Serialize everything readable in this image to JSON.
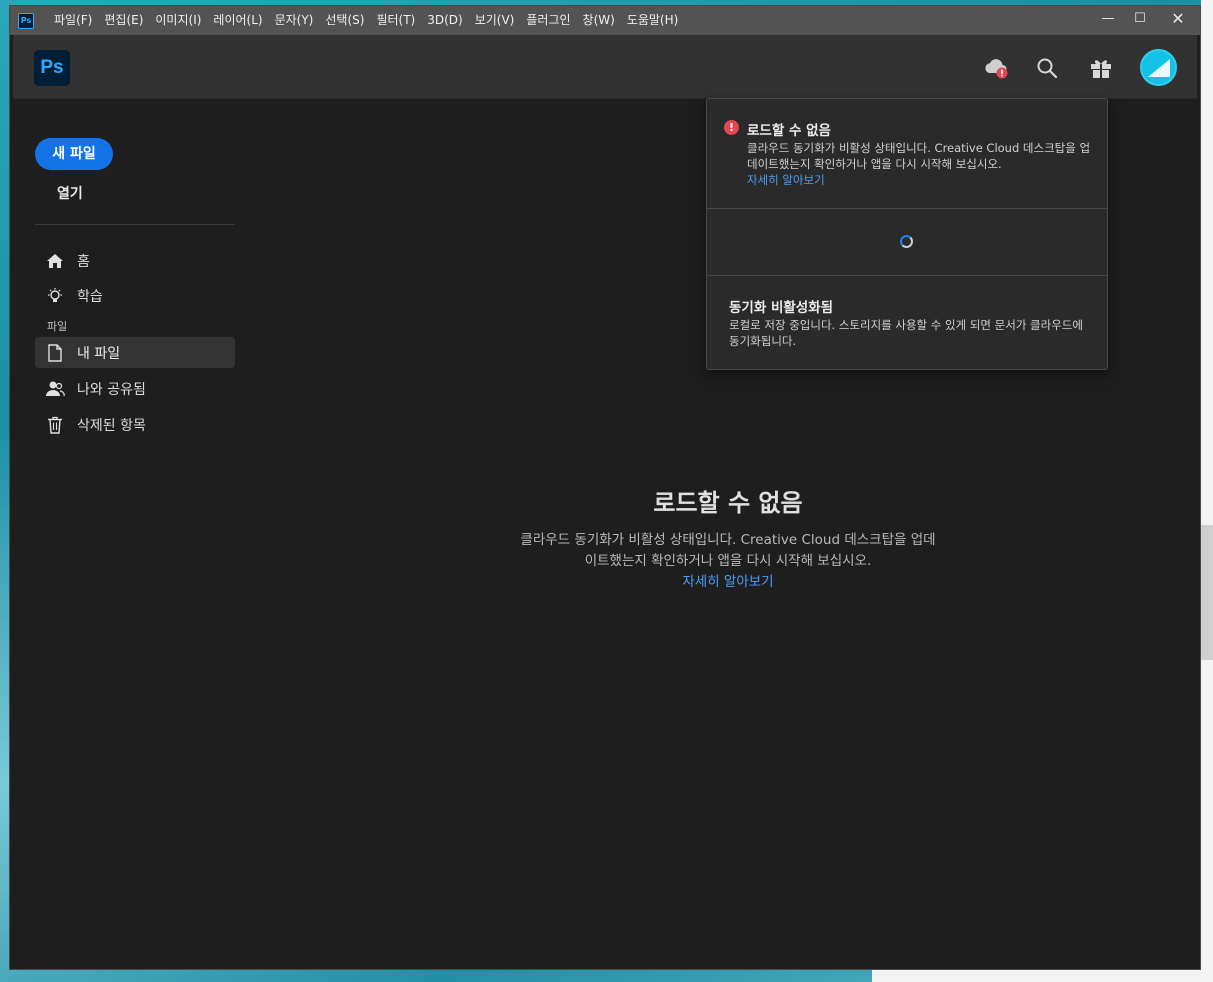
{
  "app": {
    "mini_icon": "Ps"
  },
  "menu": [
    "파일(F)",
    "편집(E)",
    "이미지(I)",
    "레이어(L)",
    "문자(Y)",
    "선택(S)",
    "필터(T)",
    "3D(D)",
    "보기(V)",
    "플러그인",
    "창(W)",
    "도움말(H)"
  ],
  "window_controls": {
    "minimize": "—",
    "maximize": "☐",
    "close": "✕"
  },
  "header": {
    "logo": "Ps",
    "icons": [
      "cloud-error-icon",
      "search-icon",
      "gift-icon"
    ]
  },
  "sidebar": {
    "new_file": "새 파일",
    "open": "열기",
    "home": "홈",
    "learn": "학습",
    "section_files": "파일",
    "my_files": "내 파일",
    "shared": "나와 공유됨",
    "deleted": "삭제된 항목"
  },
  "main": {
    "title": "로드할 수 없음",
    "desc_line1": "클라우드 동기화가 비활성 상태입니다. Creative Cloud 데스크탑을 업데",
    "desc_line2": "이트했는지 확인하거나 앱을 다시 시작해 보십시오.",
    "link": "자세히 알아보기"
  },
  "popover": {
    "error_title": "로드할 수 없음",
    "error_desc": "클라우드 동기화가 비활성 상태입니다. Creative Cloud 데스크탑을 업데이트했는지 확인하거나 앱을 다시 시작해 보십시오.",
    "error_link": "자세히 알아보기",
    "sync_title": "동기화 비활성화됨",
    "sync_desc": "로컬로 저장 중입니다. 스토리지를 사용할 수 있게 되면 문서가 클라우드에 동기화됩니다."
  },
  "colors": {
    "accent": "#1473e6",
    "link": "#4b9cf5",
    "error": "#e34850",
    "ps_blue": "#31a8ff"
  }
}
